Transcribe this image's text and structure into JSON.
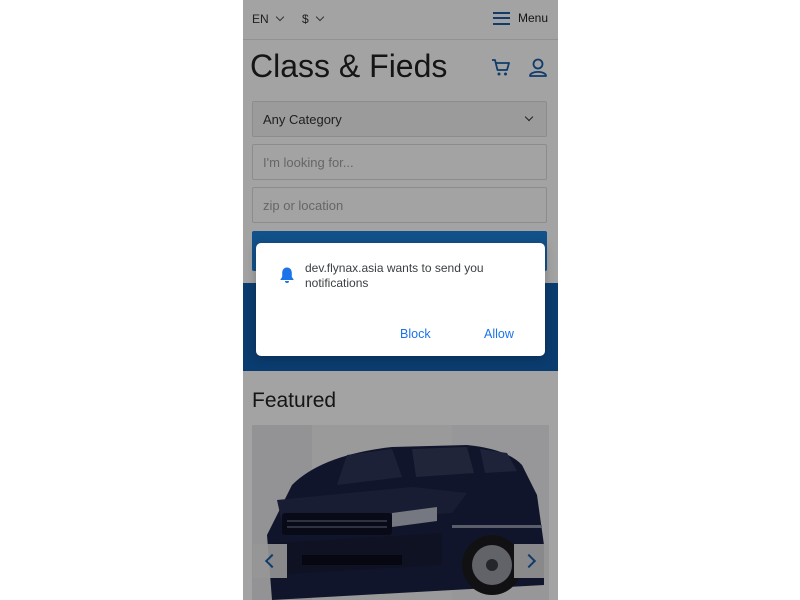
{
  "topbar": {
    "language": "EN",
    "currency": "$",
    "menu_label": "Menu"
  },
  "header": {
    "title": "Class & Fieds",
    "icons": [
      "cart-icon",
      "user-icon"
    ]
  },
  "search": {
    "category_selected": "Any Category",
    "keyword_placeholder": "I'm looking for...",
    "location_placeholder": "zip or location"
  },
  "featured": {
    "heading": "Featured",
    "image_subject": "dark blue SUV"
  },
  "notification_prompt": {
    "message": "dev.flynax.asia wants to send you notifications",
    "block_label": "Block",
    "allow_label": "Allow",
    "icon": "bell-icon"
  },
  "colors": {
    "brand_blue": "#125fae",
    "button_blue": "#1e7fd8",
    "dialog_link": "#1a73e8",
    "overlay": "rgba(0,0,0,0.36)"
  }
}
